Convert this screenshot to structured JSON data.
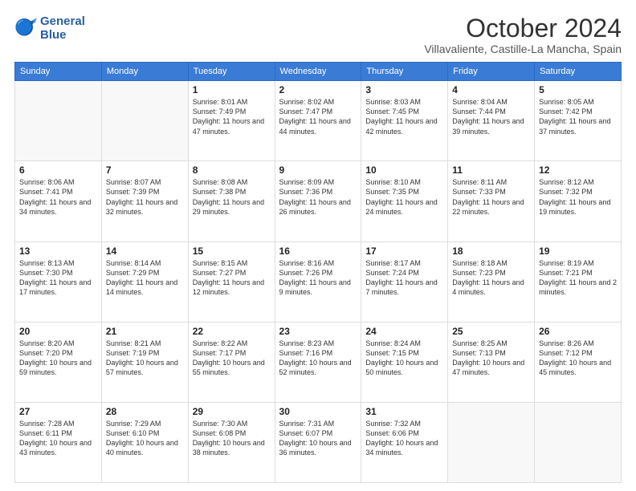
{
  "logo": {
    "line1": "General",
    "line2": "Blue"
  },
  "title": "October 2024",
  "location": "Villavaliente, Castille-La Mancha, Spain",
  "weekdays": [
    "Sunday",
    "Monday",
    "Tuesday",
    "Wednesday",
    "Thursday",
    "Friday",
    "Saturday"
  ],
  "weeks": [
    [
      {
        "day": "",
        "empty": true
      },
      {
        "day": "",
        "empty": true
      },
      {
        "day": "1",
        "sunrise": "Sunrise: 8:01 AM",
        "sunset": "Sunset: 7:49 PM",
        "daylight": "Daylight: 11 hours and 47 minutes."
      },
      {
        "day": "2",
        "sunrise": "Sunrise: 8:02 AM",
        "sunset": "Sunset: 7:47 PM",
        "daylight": "Daylight: 11 hours and 44 minutes."
      },
      {
        "day": "3",
        "sunrise": "Sunrise: 8:03 AM",
        "sunset": "Sunset: 7:45 PM",
        "daylight": "Daylight: 11 hours and 42 minutes."
      },
      {
        "day": "4",
        "sunrise": "Sunrise: 8:04 AM",
        "sunset": "Sunset: 7:44 PM",
        "daylight": "Daylight: 11 hours and 39 minutes."
      },
      {
        "day": "5",
        "sunrise": "Sunrise: 8:05 AM",
        "sunset": "Sunset: 7:42 PM",
        "daylight": "Daylight: 11 hours and 37 minutes."
      }
    ],
    [
      {
        "day": "6",
        "sunrise": "Sunrise: 8:06 AM",
        "sunset": "Sunset: 7:41 PM",
        "daylight": "Daylight: 11 hours and 34 minutes."
      },
      {
        "day": "7",
        "sunrise": "Sunrise: 8:07 AM",
        "sunset": "Sunset: 7:39 PM",
        "daylight": "Daylight: 11 hours and 32 minutes."
      },
      {
        "day": "8",
        "sunrise": "Sunrise: 8:08 AM",
        "sunset": "Sunset: 7:38 PM",
        "daylight": "Daylight: 11 hours and 29 minutes."
      },
      {
        "day": "9",
        "sunrise": "Sunrise: 8:09 AM",
        "sunset": "Sunset: 7:36 PM",
        "daylight": "Daylight: 11 hours and 26 minutes."
      },
      {
        "day": "10",
        "sunrise": "Sunrise: 8:10 AM",
        "sunset": "Sunset: 7:35 PM",
        "daylight": "Daylight: 11 hours and 24 minutes."
      },
      {
        "day": "11",
        "sunrise": "Sunrise: 8:11 AM",
        "sunset": "Sunset: 7:33 PM",
        "daylight": "Daylight: 11 hours and 22 minutes."
      },
      {
        "day": "12",
        "sunrise": "Sunrise: 8:12 AM",
        "sunset": "Sunset: 7:32 PM",
        "daylight": "Daylight: 11 hours and 19 minutes."
      }
    ],
    [
      {
        "day": "13",
        "sunrise": "Sunrise: 8:13 AM",
        "sunset": "Sunset: 7:30 PM",
        "daylight": "Daylight: 11 hours and 17 minutes."
      },
      {
        "day": "14",
        "sunrise": "Sunrise: 8:14 AM",
        "sunset": "Sunset: 7:29 PM",
        "daylight": "Daylight: 11 hours and 14 minutes."
      },
      {
        "day": "15",
        "sunrise": "Sunrise: 8:15 AM",
        "sunset": "Sunset: 7:27 PM",
        "daylight": "Daylight: 11 hours and 12 minutes."
      },
      {
        "day": "16",
        "sunrise": "Sunrise: 8:16 AM",
        "sunset": "Sunset: 7:26 PM",
        "daylight": "Daylight: 11 hours and 9 minutes."
      },
      {
        "day": "17",
        "sunrise": "Sunrise: 8:17 AM",
        "sunset": "Sunset: 7:24 PM",
        "daylight": "Daylight: 11 hours and 7 minutes."
      },
      {
        "day": "18",
        "sunrise": "Sunrise: 8:18 AM",
        "sunset": "Sunset: 7:23 PM",
        "daylight": "Daylight: 11 hours and 4 minutes."
      },
      {
        "day": "19",
        "sunrise": "Sunrise: 8:19 AM",
        "sunset": "Sunset: 7:21 PM",
        "daylight": "Daylight: 11 hours and 2 minutes."
      }
    ],
    [
      {
        "day": "20",
        "sunrise": "Sunrise: 8:20 AM",
        "sunset": "Sunset: 7:20 PM",
        "daylight": "Daylight: 10 hours and 59 minutes."
      },
      {
        "day": "21",
        "sunrise": "Sunrise: 8:21 AM",
        "sunset": "Sunset: 7:19 PM",
        "daylight": "Daylight: 10 hours and 57 minutes."
      },
      {
        "day": "22",
        "sunrise": "Sunrise: 8:22 AM",
        "sunset": "Sunset: 7:17 PM",
        "daylight": "Daylight: 10 hours and 55 minutes."
      },
      {
        "day": "23",
        "sunrise": "Sunrise: 8:23 AM",
        "sunset": "Sunset: 7:16 PM",
        "daylight": "Daylight: 10 hours and 52 minutes."
      },
      {
        "day": "24",
        "sunrise": "Sunrise: 8:24 AM",
        "sunset": "Sunset: 7:15 PM",
        "daylight": "Daylight: 10 hours and 50 minutes."
      },
      {
        "day": "25",
        "sunrise": "Sunrise: 8:25 AM",
        "sunset": "Sunset: 7:13 PM",
        "daylight": "Daylight: 10 hours and 47 minutes."
      },
      {
        "day": "26",
        "sunrise": "Sunrise: 8:26 AM",
        "sunset": "Sunset: 7:12 PM",
        "daylight": "Daylight: 10 hours and 45 minutes."
      }
    ],
    [
      {
        "day": "27",
        "sunrise": "Sunrise: 7:28 AM",
        "sunset": "Sunset: 6:11 PM",
        "daylight": "Daylight: 10 hours and 43 minutes."
      },
      {
        "day": "28",
        "sunrise": "Sunrise: 7:29 AM",
        "sunset": "Sunset: 6:10 PM",
        "daylight": "Daylight: 10 hours and 40 minutes."
      },
      {
        "day": "29",
        "sunrise": "Sunrise: 7:30 AM",
        "sunset": "Sunset: 6:08 PM",
        "daylight": "Daylight: 10 hours and 38 minutes."
      },
      {
        "day": "30",
        "sunrise": "Sunrise: 7:31 AM",
        "sunset": "Sunset: 6:07 PM",
        "daylight": "Daylight: 10 hours and 36 minutes."
      },
      {
        "day": "31",
        "sunrise": "Sunrise: 7:32 AM",
        "sunset": "Sunset: 6:06 PM",
        "daylight": "Daylight: 10 hours and 34 minutes."
      },
      {
        "day": "",
        "empty": true
      },
      {
        "day": "",
        "empty": true
      }
    ]
  ]
}
